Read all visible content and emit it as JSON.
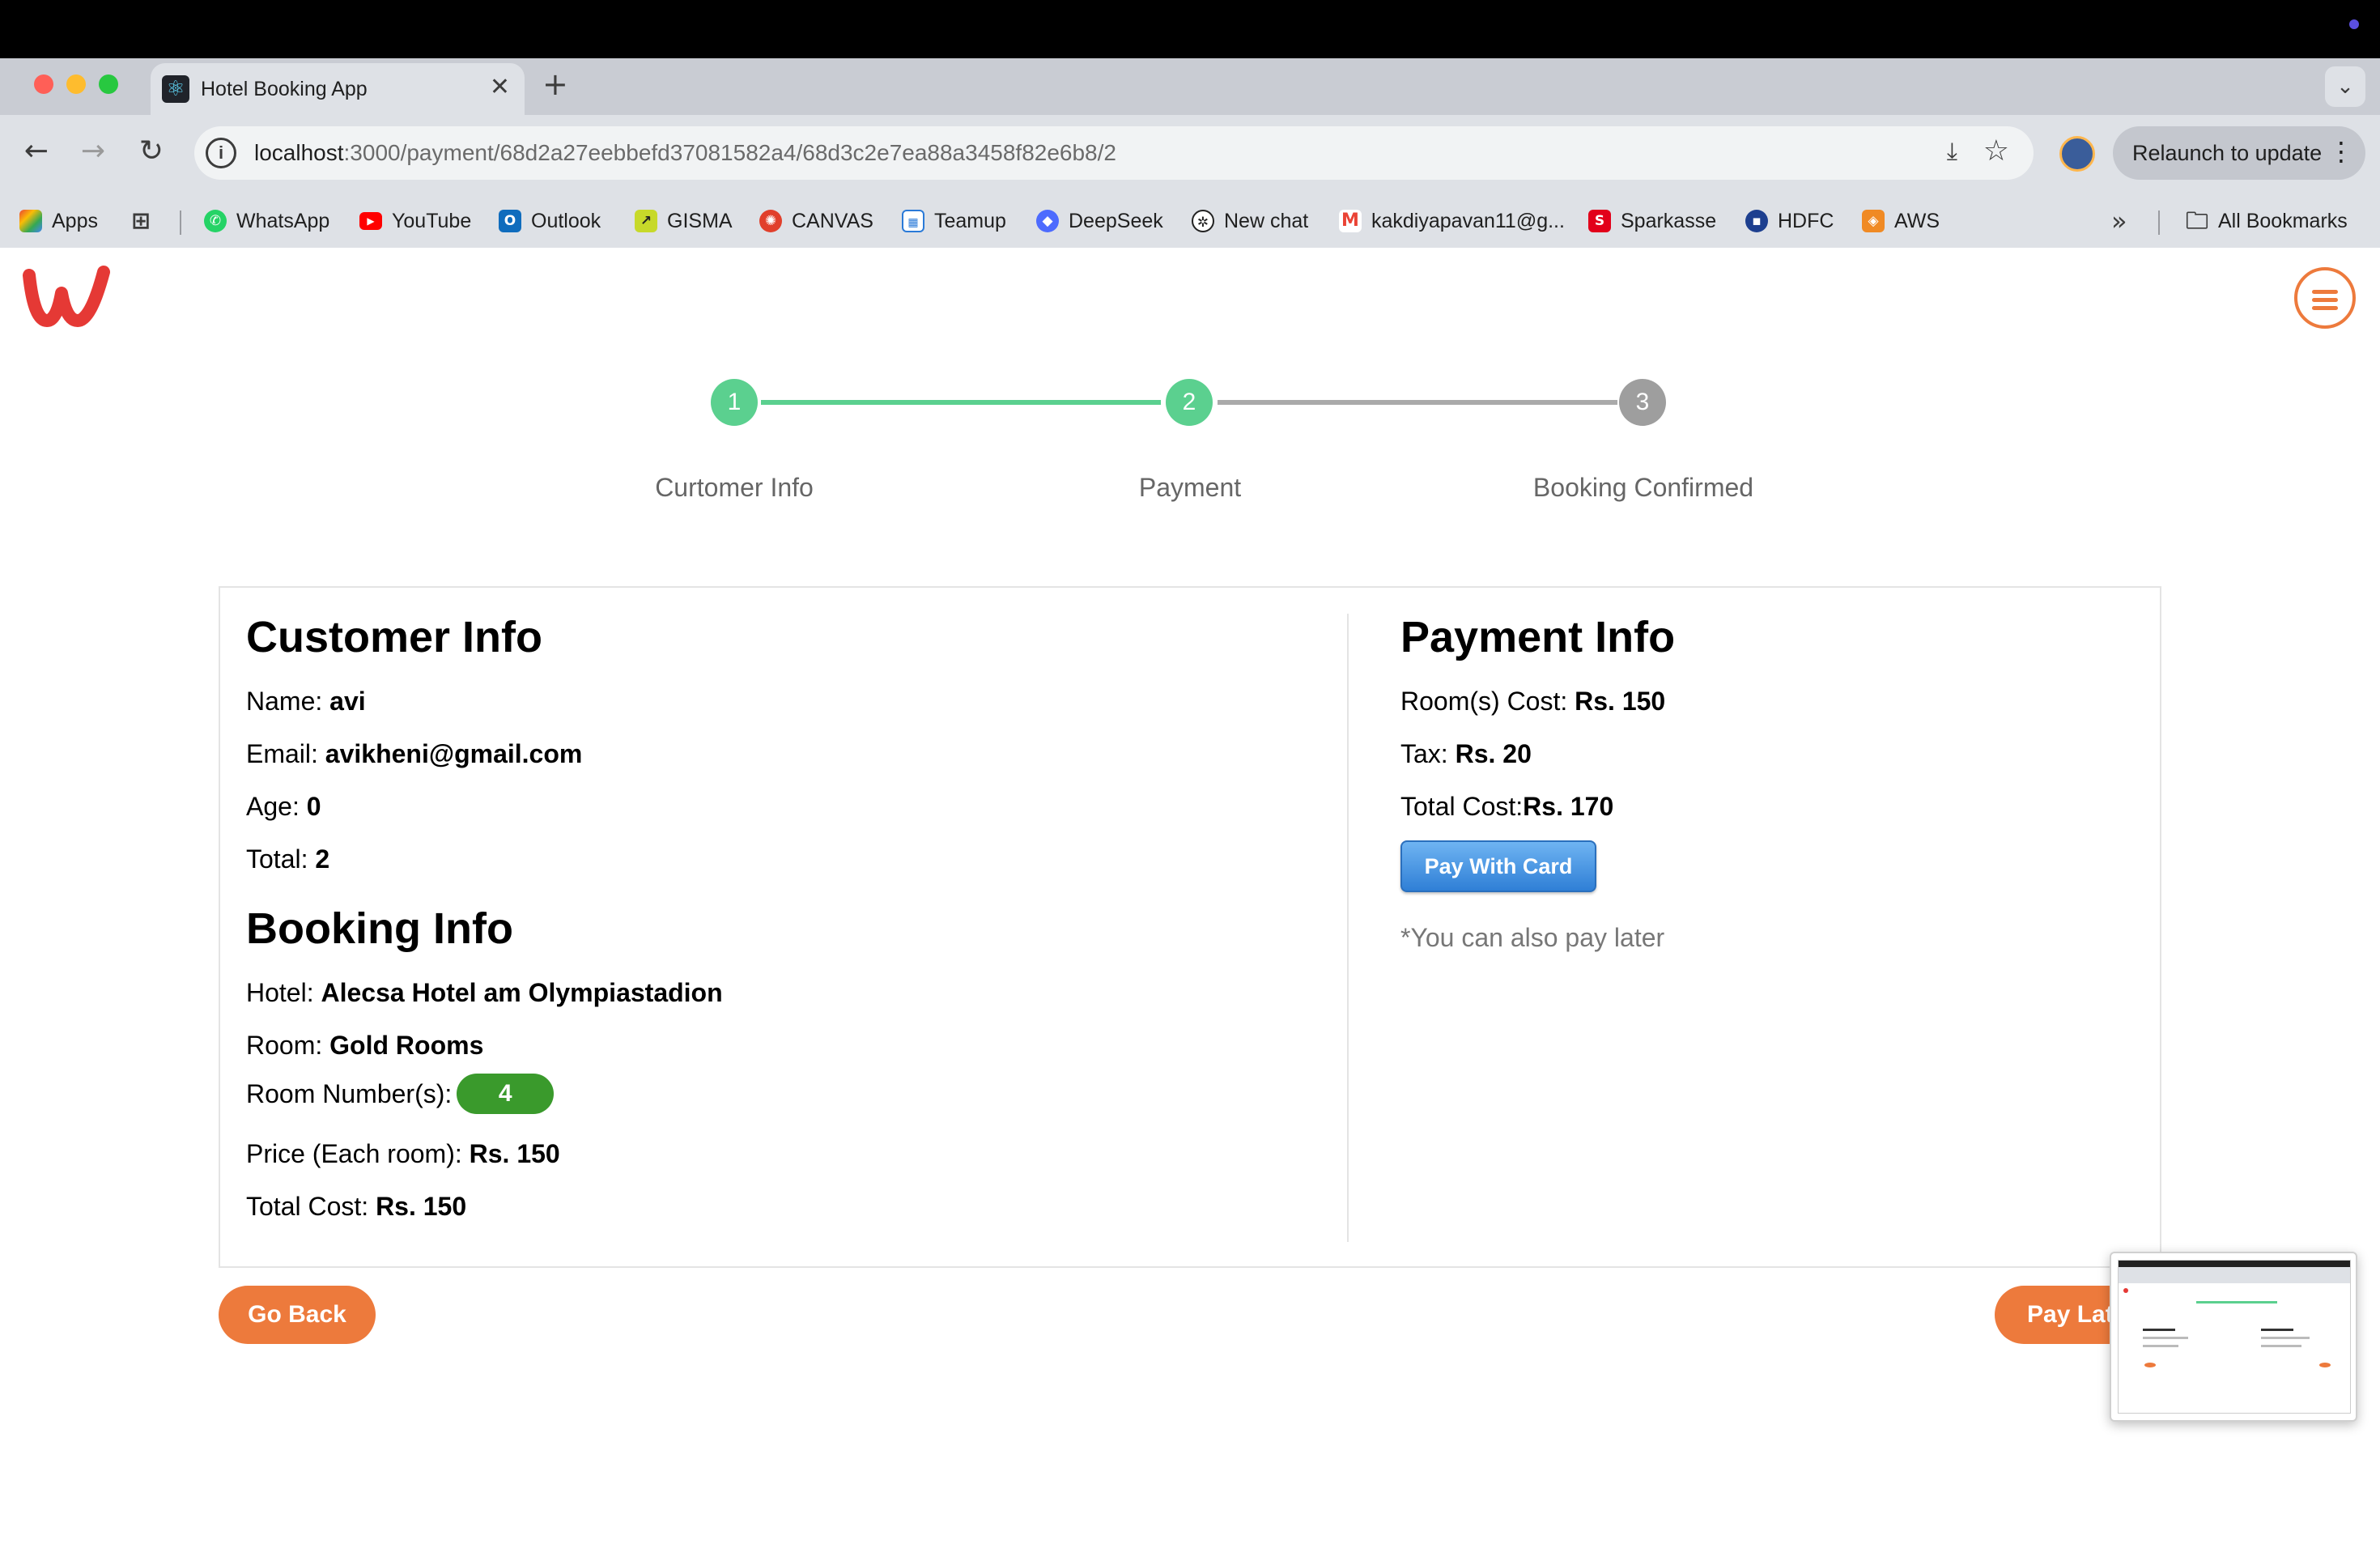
{
  "browser": {
    "tab_title": "Hotel Booking App",
    "url_host": "localhost",
    "url_path": ":3000/payment/68d2a27eebbefd37081582a4/68d3c2e7ea88a3458f82e6b8/2",
    "relaunch_label": "Relaunch to update",
    "bookmarks": [
      {
        "label": "Apps"
      },
      {
        "label": "WhatsApp"
      },
      {
        "label": "YouTube"
      },
      {
        "label": "Outlook"
      },
      {
        "label": "GISMA"
      },
      {
        "label": "CANVAS"
      },
      {
        "label": "Teamup"
      },
      {
        "label": "DeepSeek"
      },
      {
        "label": "New chat"
      },
      {
        "label": "kakdiyapavan11@g..."
      },
      {
        "label": "Sparkasse"
      },
      {
        "label": "HDFC"
      },
      {
        "label": "AWS"
      }
    ],
    "all_bookmarks_label": "All Bookmarks"
  },
  "stepper": {
    "steps": [
      {
        "number": "1",
        "label": "Curtomer Info",
        "state": "complete"
      },
      {
        "number": "2",
        "label": "Payment",
        "state": "active"
      },
      {
        "number": "3",
        "label": "Booking Confirmed",
        "state": "pending"
      }
    ]
  },
  "customer": {
    "title": "Customer Info",
    "name_label": "Name: ",
    "name": "avi",
    "email_label": "Email: ",
    "email": "avikheni@gmail.com",
    "age_label": "Age: ",
    "age": "0",
    "total_label": "Total: ",
    "total": "2"
  },
  "booking": {
    "title": "Booking Info",
    "hotel_label": "Hotel: ",
    "hotel": "Alecsa Hotel am Olympiastadion",
    "room_label": "Room: ",
    "room": "Gold Rooms",
    "room_numbers_label": "Room Number(s): ",
    "room_numbers": [
      "4"
    ],
    "price_label": "Price (Each room): ",
    "price": "Rs. 150",
    "total_cost_label": "Total Cost: ",
    "total_cost": "Rs. 150"
  },
  "payment": {
    "title": "Payment Info",
    "rooms_cost_label": "Room(s) Cost: ",
    "rooms_cost": "Rs. 150",
    "tax_label": "Tax: ",
    "tax": "Rs. 20",
    "total_cost_label": "Total Cost:",
    "total_cost": "Rs. 170",
    "pay_card_label": "Pay With Card",
    "pay_later_note": "*You can also pay later"
  },
  "actions": {
    "go_back_label": "Go Back",
    "pay_later_label": "Pay Lat"
  },
  "colors": {
    "accent": "#ed7a3c",
    "step_complete": "#5bd08f",
    "step_pending": "#9e9e9e",
    "room_badge": "#3a9a2c",
    "pay_button": "#2f7fd6",
    "logo": "#e53935"
  }
}
